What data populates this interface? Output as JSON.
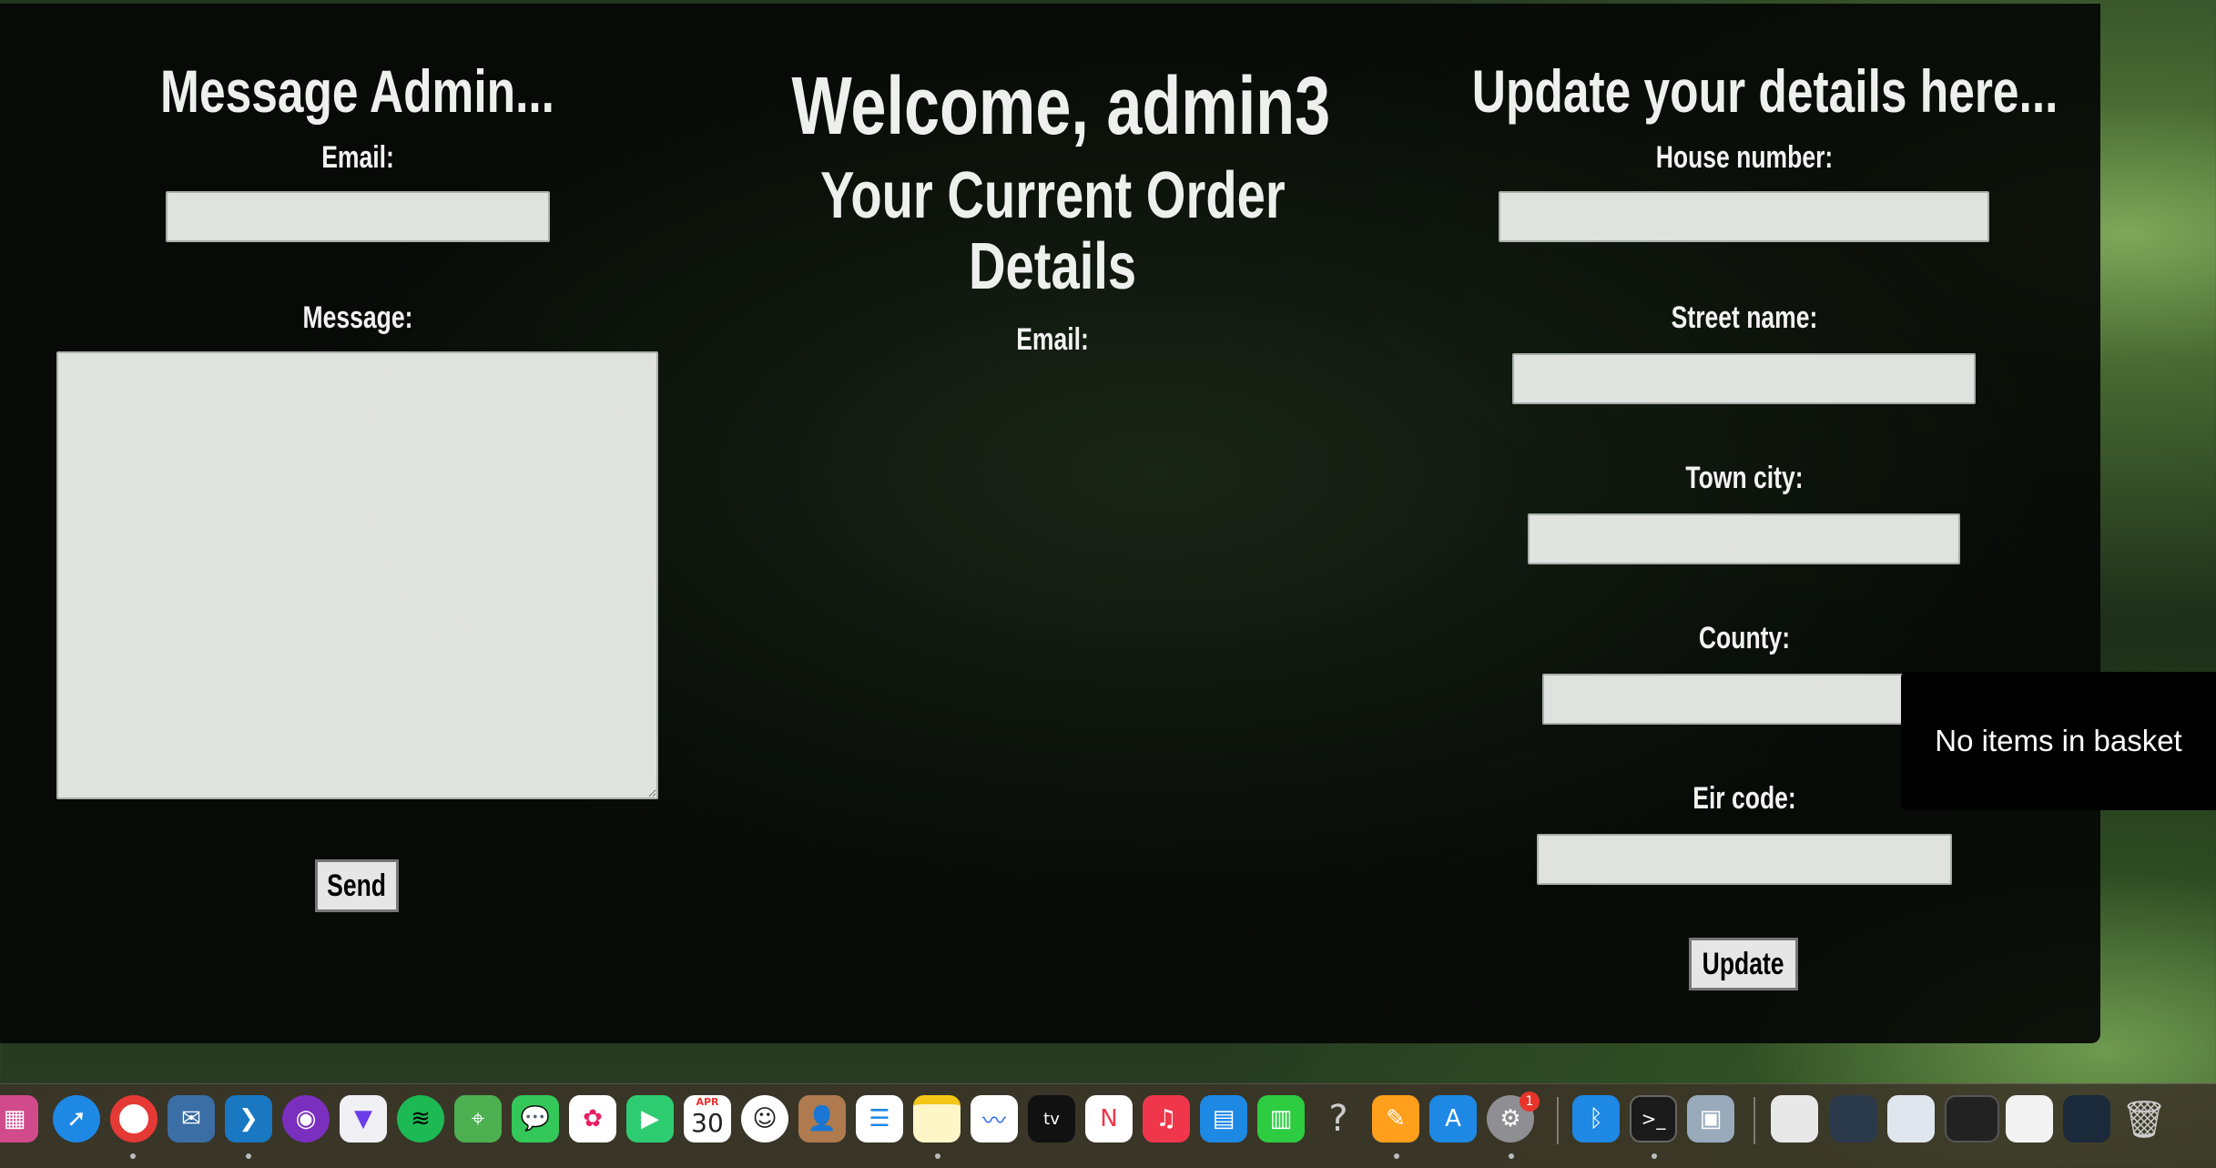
{
  "left": {
    "heading": "Message Admin...",
    "email_label": "Email:",
    "email_value": "",
    "message_label": "Message:",
    "message_value": "",
    "send_label": "Send"
  },
  "center": {
    "welcome": "Welcome, admin3",
    "order_heading_line1": "Your Current Order",
    "order_heading_line2": "Details",
    "email_label": "Email:"
  },
  "right": {
    "heading": "Update your details here...",
    "house_label": "House number:",
    "street_label": "Street name:",
    "town_label": "Town city:",
    "county_label": "County:",
    "eir_label": "Eir code:",
    "update_label": "Update"
  },
  "basket": {
    "text": "No items in basket"
  },
  "dock": {
    "calendar_month": "APR",
    "calendar_day": "30",
    "settings_badge": "1",
    "icons": [
      "launchpad-icon",
      "safari-icon",
      "chrome-icon",
      "mail-icon",
      "vscode-icon",
      "podcasts-icon",
      "proton-vpn-icon",
      "spotify-icon",
      "maps-icon",
      "messages-icon",
      "photos-icon",
      "facetime-icon",
      "calendar-icon",
      "emoji-icon",
      "contacts-icon",
      "reminders-icon",
      "notes-icon",
      "freeform-icon",
      "apple-tv-icon",
      "news-icon",
      "music-icon",
      "keynote-icon",
      "numbers-icon",
      "help-icon",
      "pages-icon",
      "app-store-icon",
      "system-settings-icon",
      "bluetooth-icon",
      "terminal-icon",
      "preview-icon",
      "document-icon",
      "window-thumbnail-icon",
      "window-thumbnail-icon",
      "window-thumbnail-icon",
      "window-thumbnail-icon",
      "window-thumbnail-icon",
      "trash-icon"
    ]
  }
}
